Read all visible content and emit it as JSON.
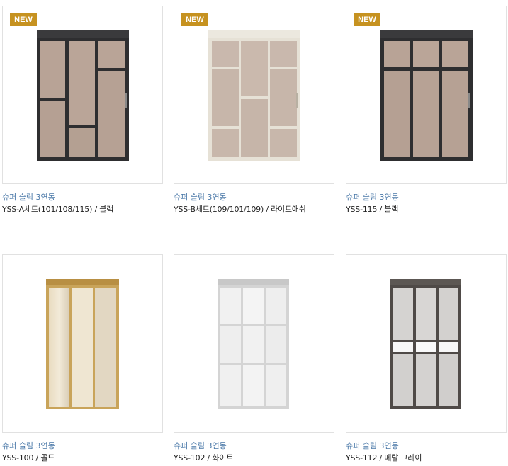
{
  "products": [
    {
      "badge": "NEW",
      "category": "슈퍼 슬림 3연동",
      "model": "YSS-A세트(101/108/115) / 블랙",
      "finish_color": "#2e2e30"
    },
    {
      "badge": "NEW",
      "category": "슈퍼 슬림 3연동",
      "model": "YSS-B세트(109/101/109) / 라이트애쉬",
      "finish_color": "#e6e1d6"
    },
    {
      "badge": "NEW",
      "category": "슈퍼 슬림 3연동",
      "model": "YSS-115 / 블랙",
      "finish_color": "#2e2e30"
    },
    {
      "badge": "",
      "category": "슈퍼 슬림 3연동",
      "model": "YSS-100 / 골드",
      "finish_color": "#c9a45a"
    },
    {
      "badge": "",
      "category": "슈퍼 슬림 3연동",
      "model": "YSS-102 / 화이트",
      "finish_color": "#dcdcdc"
    },
    {
      "badge": "",
      "category": "슈퍼 슬림 3연동",
      "model": "YSS-112 / 메탈 그레이",
      "finish_color": "#4f4a47"
    }
  ],
  "colors": {
    "badge": "#c69220",
    "category_text": "#4a78a8",
    "border": "#e1e1e1"
  }
}
